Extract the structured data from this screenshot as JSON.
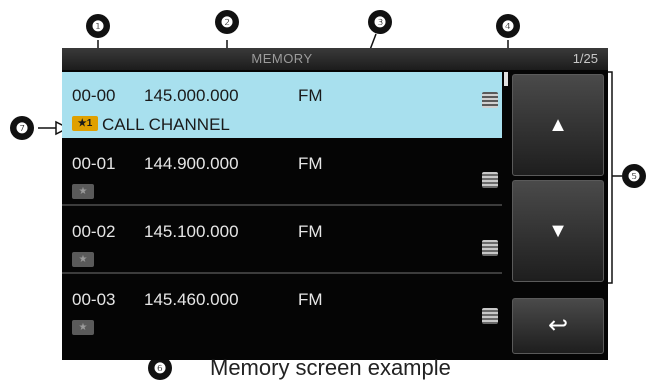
{
  "screen": {
    "title": "MEMORY",
    "page_indicator": "1/25",
    "rows": [
      {
        "channel": "00-00",
        "frequency": "145.000.000",
        "mode": "FM",
        "name": "CALL CHANNEL",
        "star_label": "★1",
        "selected": true
      },
      {
        "channel": "00-01",
        "frequency": "144.900.000",
        "mode": "FM",
        "name": "",
        "star_label": "★",
        "selected": false
      },
      {
        "channel": "00-02",
        "frequency": "145.100.000",
        "mode": "FM",
        "name": "",
        "star_label": "★",
        "selected": false
      },
      {
        "channel": "00-03",
        "frequency": "145.460.000",
        "mode": "FM",
        "name": "",
        "star_label": "★",
        "selected": false
      }
    ],
    "buttons": {
      "up": "▲",
      "down": "▼",
      "back": "↩"
    }
  },
  "callouts": [
    "❶",
    "❷",
    "❸",
    "❹",
    "❺",
    "❻",
    "❼"
  ],
  "caption": "Memory screen example"
}
